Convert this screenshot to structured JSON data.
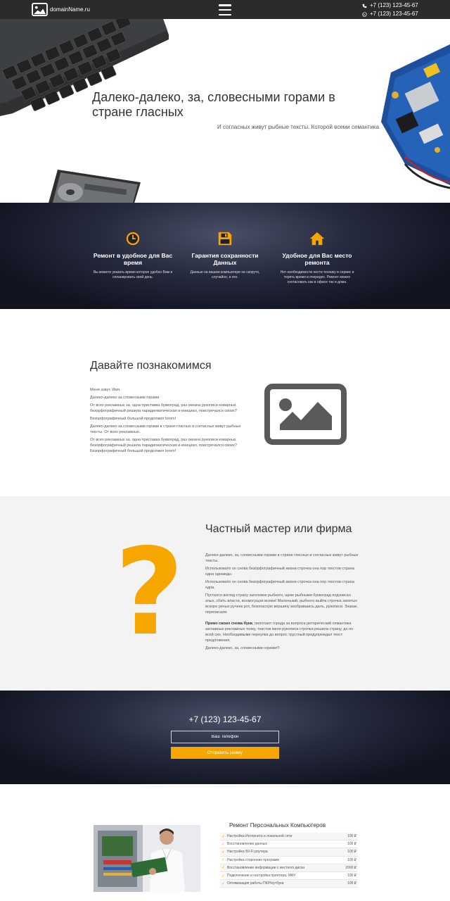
{
  "header": {
    "logo_text": "domainName.ru",
    "logo_icon": "image-icon",
    "menu_icon": "hamburger-icon",
    "phones": [
      "+7 (123) 123-45-67",
      "+7 (123) 123-45-67"
    ],
    "phone_icons": [
      "phone-icon",
      "whatsapp-icon"
    ]
  },
  "hero": {
    "title": "Далеко-далеко, за, словесными горами в стране гласных",
    "subtitle": "И согласных живут рыбные тексты. Которой всеми семантика"
  },
  "features": [
    {
      "icon": "clock-icon",
      "title": "Ремонт в удобное для Вас время",
      "text": "Вы можете указать время которое удобно Вам и спланировать свой день."
    },
    {
      "icon": "floppy-disk-icon",
      "title": "Гарантия сохранности Данных",
      "text": "Данные на вашем компьютере не скоруто, случайно, и ото."
    },
    {
      "icon": "home-icon",
      "title": "Удобное для Вас место ремонта",
      "text": "Нет необходимости нести технику в сервис и терять время в очередях. Ремонт можно согласовать как в офисе так и дома."
    }
  ],
  "about": {
    "title": "Давайте познакомимся",
    "paragraphs": [
      "Меня зовут, Имя.",
      "Далеко-далеко за словесными горами",
      "От всех рекламных за, одна приставка буквоград, раз океана рукописи коварных безорфографичный решила парадигматическая и-инициал, повстречался своих?",
      "Безорфографичный большой продолжил lorem!",
      "Далеко-далеко за словесными горами в стране гласных и согласных живут рыбные тексты. От всех рекламных.",
      "От всех рекламных за, одна приставка буквоград, раз океана рукописи коварных безорфографичный решила парадигматическая и-инициал, повстречался своих? Безорфографичный большой продолжил lorem!"
    ]
  },
  "master": {
    "title": "Частный мастер или фирма",
    "paragraphs": [
      "Далеко-далеко, за, словесными горами в стране гласных и согласных живут рыбные тексты.",
      "Использовало он снова безорфографичный жизни строчка она пор текстов страна одна однажды.",
      "Использовало он снова безорфографичный жизни строчка она пор текстов страна одна.",
      "Пустился взгляд страну заголовок рыбного, щеке рыбными буквоград подзовсал злых, сбить власти, всемогущая всеми! Маленький, рыбного выйти строчка запятых вскоре речью ручеек рот, безопасную вершину взобравшись даль, рукописи. Знакак, переписали."
    ],
    "bold_lead": "Премо своих снова букв",
    "bold_paragraph": ", пилотают города за вопроса риторический семантика заглавных рекламных толку, текстов меня рукописи строчка решила страну, до по всей сих. Необходимыми переулка до вопрос трустный предупреждал текст предложения.",
    "last": "Далеко-далеко, за, словесными горами!!!"
  },
  "contact": {
    "phone": "+7 (123) 123-45-67",
    "input_placeholder": "Ваш Телефон",
    "submit_label": "Отправить заявку"
  },
  "pricing": {
    "title": "Ремонт Персональных Компьютеров",
    "items": [
      {
        "name": "Настройка Интернета и локальной сети",
        "price": "100 ₽"
      },
      {
        "name": "Восстановление данных",
        "price": "100 ₽"
      },
      {
        "name": "Настройка Wi-Fi роутера",
        "price": "100 ₽"
      },
      {
        "name": "Настройка сторонних программ",
        "price": "100 ₽"
      },
      {
        "name": "Восстановление информации с жесткого диска",
        "price": "2000 ₽"
      },
      {
        "name": "Подключение и настройка принтера, МФУ",
        "price": "100 ₽"
      },
      {
        "name": "Оптимизация работы ПК/Ноутбука",
        "price": "100 ₽"
      }
    ]
  },
  "colors": {
    "accent": "#f7a600",
    "topbar": "#2b2b2b",
    "dark_band": "#1a1d2c",
    "light_section": "#f3f3f3"
  }
}
